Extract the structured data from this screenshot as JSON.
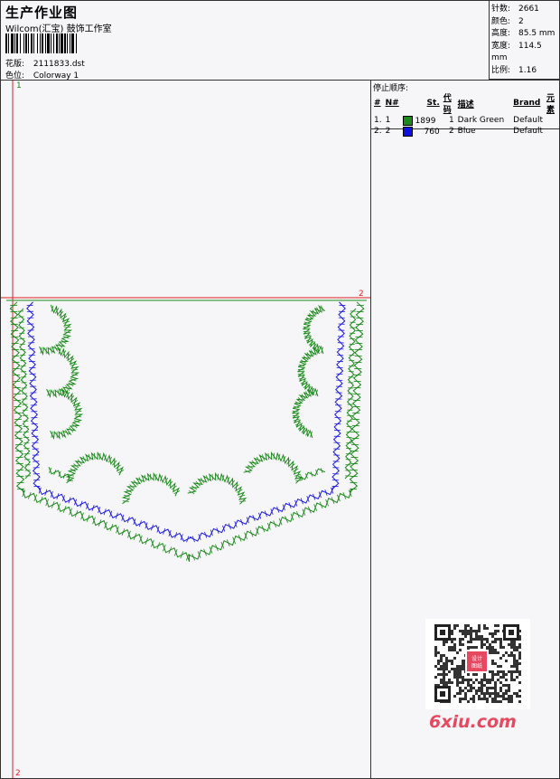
{
  "header": {
    "title": "生产作业图",
    "subtitle": "Wilcom(汇宝) 鼓饰工作室",
    "design_label": "花版:",
    "design_value": "2111833.dst",
    "colorway_label": "色位:",
    "colorway_value": "Colorway 1"
  },
  "stats": [
    {
      "label": "针数:",
      "value": "2661"
    },
    {
      "label": "颜色:",
      "value": "2"
    },
    {
      "label": "高度:",
      "value": "85.5 mm"
    },
    {
      "label": "宽度:",
      "value": "114.5 mm"
    },
    {
      "label": "比例:",
      "value": "1.16"
    }
  ],
  "stops": {
    "title": "停止顺序:",
    "columns": [
      "#",
      "N#",
      "St.",
      "代码",
      "描述",
      "Brand",
      "元素"
    ],
    "rows": [
      {
        "index": "1.",
        "n": "1",
        "st": "1899",
        "code": "1",
        "desc": "Dark Green",
        "brand": "Default",
        "color": "#1a8a1a"
      },
      {
        "index": "2.",
        "n": "2",
        "st": "760",
        "code": "2",
        "desc": "Blue",
        "brand": "Default",
        "color": "#1010e0"
      }
    ]
  },
  "markers": {
    "start": "1",
    "end_right": "2",
    "end_bottom": "2"
  },
  "colors": {
    "green": "#1a8a1a",
    "blue": "#1a1ae0",
    "red": "#e02020"
  },
  "watermark": {
    "brand": "6xiu.com",
    "seal": "设计图纸"
  }
}
